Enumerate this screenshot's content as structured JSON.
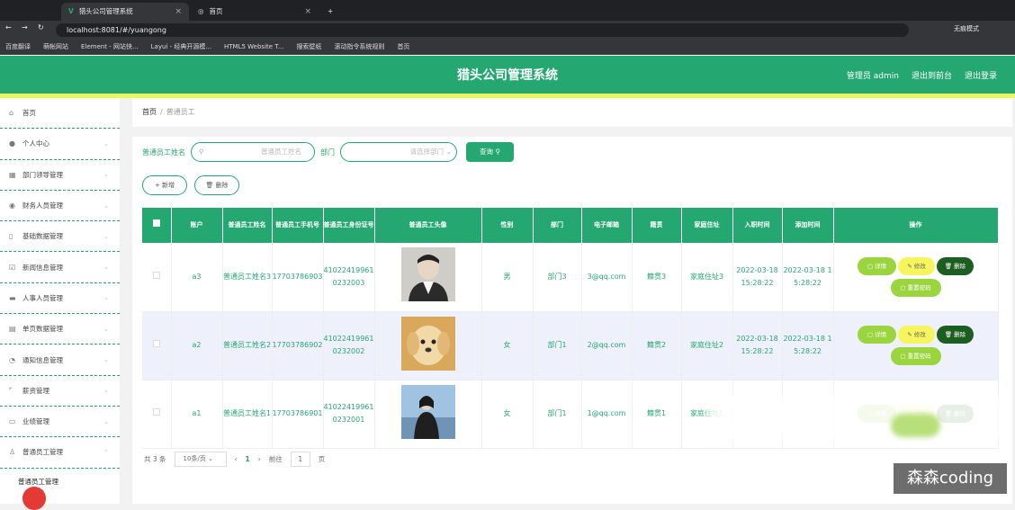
{
  "browser": {
    "tabs": [
      {
        "title": "猎头公司管理系统"
      },
      {
        "title": "首页"
      }
    ],
    "url": "localhost:8081/#/yuangong",
    "profile": "无痕模式",
    "bookmarks": [
      "百度翻译",
      "萌帐网站",
      "Element - 网站快...",
      "Layui - 经典开源模...",
      "HTML5 Website T...",
      "搜索壁纸",
      "滚动指令系统规则",
      "首页"
    ]
  },
  "header": {
    "title": "猎头公司管理系统",
    "user": "管理员 admin",
    "back_label": "退出到前台",
    "logout_label": "退出登录"
  },
  "sidebar": {
    "items": [
      {
        "label": "首页",
        "icon": "home-icon"
      },
      {
        "label": "个人中心",
        "icon": "user-icon"
      },
      {
        "label": "部门领导管理",
        "icon": "grid-icon"
      },
      {
        "label": "财务人员管理",
        "icon": "pin-icon"
      },
      {
        "label": "基础数据管理",
        "icon": "phone-icon"
      },
      {
        "label": "新闻信息管理",
        "icon": "doc-icon"
      },
      {
        "label": "人事人员管理",
        "icon": "monitor-icon"
      },
      {
        "label": "单页数据管理",
        "icon": "table-icon"
      },
      {
        "label": "通知信息管理",
        "icon": "gauge-icon"
      },
      {
        "label": "薪资管理",
        "icon": "frame-icon"
      },
      {
        "label": "业绩管理",
        "icon": "chat-icon"
      },
      {
        "label": "普通员工管理",
        "icon": "person-icon"
      }
    ],
    "sub_item": "普通员工管理"
  },
  "breadcrumb": {
    "home": "首页",
    "current": "普通员工"
  },
  "search": {
    "name_label": "普通员工姓名",
    "name_placeholder": "普通员工姓名",
    "dept_label": "部门",
    "dept_placeholder": "请选择部门",
    "query_label": "查询"
  },
  "actions": {
    "add_label": "新增",
    "delete_label": "删除"
  },
  "table": {
    "headers": [
      "账户",
      "普通员工姓名",
      "普通员工手机号",
      "普通员工身份证号",
      "普通员工头像",
      "性别",
      "部门",
      "电子邮箱",
      "籍贯",
      "家庭住址",
      "入职时间",
      "添加时间",
      "操作"
    ],
    "rows": [
      {
        "account": "a3",
        "name": "普通员工姓名3",
        "phone": "17703786903",
        "idcard": "410224199610232003",
        "gender": "男",
        "dept": "部门3",
        "email": "3@qq.com",
        "origin": "籍贯3",
        "address": "家庭住址3",
        "hired": "2022-03-18 15:28:22",
        "added": "2022-03-18 15:28:22"
      },
      {
        "account": "a2",
        "name": "普通员工姓名2",
        "phone": "17703786902",
        "idcard": "410224199610232002",
        "gender": "女",
        "dept": "部门1",
        "email": "2@qq.com",
        "origin": "籍贯2",
        "address": "家庭住址2",
        "hired": "2022-03-18 15:28:22",
        "added": "2022-03-18 15:28:22"
      },
      {
        "account": "a1",
        "name": "普通员工姓名1",
        "phone": "17703786901",
        "idcard": "410224199610232001",
        "gender": "女",
        "dept": "部门1",
        "email": "1@qq.com",
        "origin": "籍贯1",
        "address": "家庭住址1",
        "hired": "",
        "added": ""
      }
    ],
    "row_actions": {
      "detail": "详情",
      "edit": "修改",
      "delete": "删除",
      "reset": "重置密码"
    }
  },
  "pager": {
    "total": "共 3 条",
    "page_size": "10条/页",
    "current": "1",
    "goto_label": "前往",
    "goto_value": "1",
    "page_unit": "页"
  },
  "watermark": "森森coding",
  "colors": {
    "primary": "#25a771",
    "accent_yellow": "#e9f75c",
    "dark_green": "#1c5e1f",
    "light_green": "#9ad53f"
  }
}
